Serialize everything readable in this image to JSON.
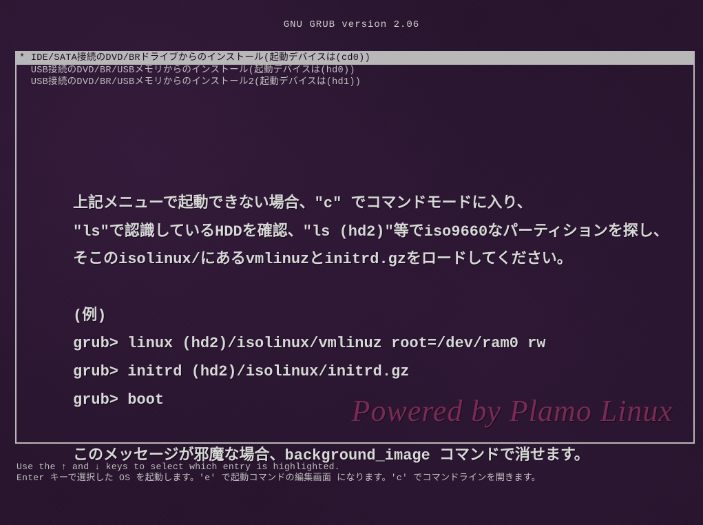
{
  "header": {
    "title": "GNU GRUB  version 2.06"
  },
  "menu": {
    "items": [
      "IDE/SATA接続のDVD/BRドライブからのインストール(起動デバイスは(cd0))",
      "USB接続のDVD/BR/USBメモリからのインストール(起動デバイスは(hd0))",
      "USB接続のDVD/BR/USBメモリからのインストール2(起動デバイスは(hd1))"
    ],
    "selected_index": 0
  },
  "background_instructions": {
    "lines": [
      "上記メニューで起動できない場合、\"c\" でコマンドモードに入り、",
      "\"ls\"で認識しているHDDを確認、\"ls (hd2)\"等でiso9660なパーティションを探し、",
      "そこのisolinux/にあるvmlinuzとinitrd.gzをロードしてください。",
      "",
      "(例)",
      "grub> linux (hd2)/isolinux/vmlinuz root=/dev/ram0 rw",
      "grub> initrd (hd2)/isolinux/initrd.gz",
      "grub> boot",
      "",
      "このメッセージが邪魔な場合、background_image コマンドで消せます。"
    ]
  },
  "powered_by": "Powered by Plamo Linux",
  "hints": {
    "line1": "Use the ↑ and ↓ keys to select which entry is highlighted.",
    "line2": "Enter キーで選択した OS を起動します。'e' で起動コマンドの編集画面 になります。'c' でコマンドラインを開きます。"
  }
}
